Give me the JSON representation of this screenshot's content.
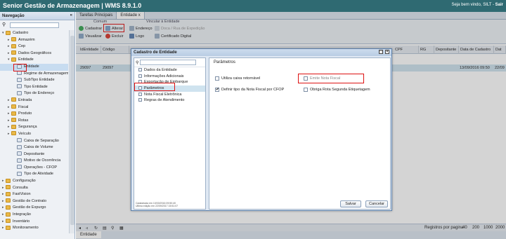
{
  "app": {
    "title": "Senior Gestão de Armazenagem | WMS 8.9.1.0",
    "welcome": "Seja bem vindo, SILT",
    "logout": "Sair"
  },
  "sidebar": {
    "title": "Navegação",
    "items": [
      {
        "label": "Cadastro",
        "toggle": "▾",
        "type": "folder",
        "selected": false
      },
      {
        "label": "Armazém",
        "toggle": "▸",
        "type": "folder",
        "selected": false
      },
      {
        "label": "Cep",
        "toggle": "▸",
        "type": "folder",
        "selected": false
      },
      {
        "label": "Dados Geográficos",
        "toggle": "▸",
        "type": "folder",
        "selected": false
      },
      {
        "label": "Entidade",
        "toggle": "▾",
        "type": "folder",
        "selected": false
      },
      {
        "label": "Entidade",
        "toggle": "",
        "type": "leaf",
        "selected": true
      },
      {
        "label": "Regime de Armazenagem",
        "toggle": "",
        "type": "leaf",
        "selected": false
      },
      {
        "label": "SubTipo Entidade",
        "toggle": "",
        "type": "leaf",
        "selected": false
      },
      {
        "label": "Tipo Entidade",
        "toggle": "",
        "type": "leaf",
        "selected": false
      },
      {
        "label": "Tipo de Endereço",
        "toggle": "",
        "type": "leaf",
        "selected": false
      },
      {
        "label": "Entrada",
        "toggle": "▸",
        "type": "folder",
        "selected": false
      },
      {
        "label": "Fiscal",
        "toggle": "▸",
        "type": "folder",
        "selected": false
      },
      {
        "label": "Produto",
        "toggle": "▸",
        "type": "folder",
        "selected": false
      },
      {
        "label": "Rotas",
        "toggle": "▸",
        "type": "folder",
        "selected": false
      },
      {
        "label": "Segurança",
        "toggle": "▸",
        "type": "folder",
        "selected": false
      },
      {
        "label": "Veículo",
        "toggle": "▸",
        "type": "folder",
        "selected": false
      },
      {
        "label": "Caixa de Separação",
        "toggle": "",
        "type": "leaf",
        "selected": false
      },
      {
        "label": "Caixa de Volume",
        "toggle": "",
        "type": "leaf",
        "selected": false
      },
      {
        "label": "Depositante",
        "toggle": "",
        "type": "leaf",
        "selected": false
      },
      {
        "label": "Motivo de Ocorrência",
        "toggle": "",
        "type": "leaf",
        "selected": false
      },
      {
        "label": "Operações - CFOP",
        "toggle": "",
        "type": "leaf",
        "selected": false
      },
      {
        "label": "Tipo de Atividade",
        "toggle": "",
        "type": "leaf",
        "selected": false
      },
      {
        "label": "Configuração",
        "toggle": "▸",
        "type": "folder",
        "selected": false
      },
      {
        "label": "Consulta",
        "toggle": "▸",
        "type": "folder",
        "selected": false
      },
      {
        "label": "FastVision",
        "toggle": "▸",
        "type": "folder",
        "selected": false
      },
      {
        "label": "Gestão de Contrato",
        "toggle": "▸",
        "type": "folder",
        "selected": false
      },
      {
        "label": "Gestão de Expurgo",
        "toggle": "▸",
        "type": "folder",
        "selected": false
      },
      {
        "label": "Integração",
        "toggle": "▸",
        "type": "folder",
        "selected": false
      },
      {
        "label": "Inventário",
        "toggle": "▸",
        "type": "folder",
        "selected": false
      },
      {
        "label": "Monitoramento",
        "toggle": "▸",
        "type": "folder",
        "selected": false
      }
    ]
  },
  "tabs": [
    {
      "label": "Tarefas Principais"
    },
    {
      "label": "Entidade",
      "close": "x"
    }
  ],
  "toolbar": {
    "group1": "Comum",
    "group2": "Vincular à Entidade",
    "cadastrar": "Cadastrar",
    "alterar": "Alterar",
    "visualizar": "Visualizar",
    "excluir": "Excluir",
    "endereco": "Endereço",
    "doca": "Doca / Rua de Expedição",
    "logo": "Logo",
    "certificado": "Certificado Digital"
  },
  "grid": {
    "headers": [
      "IdEntidade",
      "Código",
      "CPF",
      "RG",
      "Depositante",
      "Data de Cadastro",
      "Dat"
    ],
    "row": {
      "id": "29097",
      "codigo": "29097",
      "data_cadastro": "13/09/2016 09:50",
      "data2": "22/09"
    }
  },
  "pager": {
    "label": "Registros por pagina",
    "sizes": [
      "40",
      "200",
      "1000",
      "2000"
    ]
  },
  "bottom_tab": "Entidade",
  "modal": {
    "title": "Cadastro de Entidade",
    "menu": [
      {
        "label": "Dados da Entidade",
        "selected": false
      },
      {
        "label": "Informações Adicionais",
        "selected": false
      },
      {
        "label": "Exportação de Embarque",
        "selected": false
      },
      {
        "label": "Parâmetros",
        "selected": true
      },
      {
        "label": "Nota Fiscal Eletrônica",
        "selected": false
      },
      {
        "label": "Regras de Atendimento",
        "selected": false
      }
    ],
    "info1": "Cadastrada em 10/03/2016 09:50:40",
    "info2": "Ultima edição em 22/09/2017 15:51:07",
    "section_title": "Parâmetros",
    "opt_caixa": "Utiliza caixa retornável",
    "opt_cfop": "Definir tipo da Nota Fiscal por CFOP",
    "opt_cfop_mark": "✔",
    "opt_emite": "Emite Nota Fiscal",
    "opt_rota": "Obriga Rota Segunda Etiquetagem",
    "save": "Salvar",
    "cancel": "Cancelar"
  },
  "colors": {
    "topbar": "#2f6a72",
    "highlight": "#dd1111",
    "selection": "#cfe3ef"
  }
}
